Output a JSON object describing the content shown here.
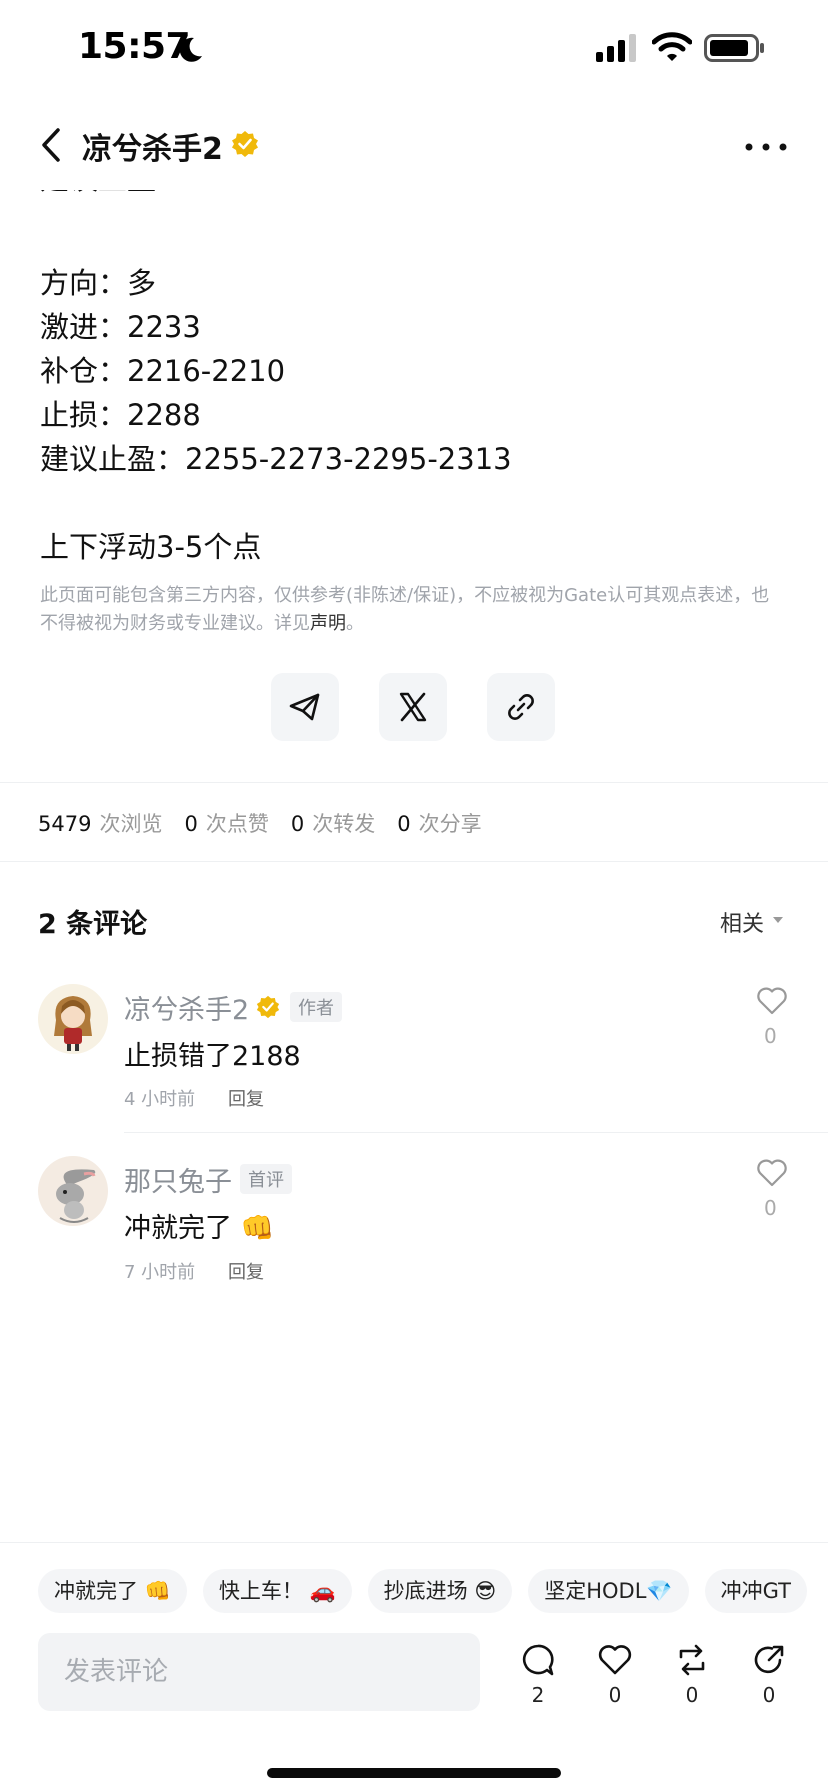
{
  "status_bar": {
    "time": "15:57"
  },
  "nav": {
    "title": "凉兮杀手2",
    "more_label": "···"
  },
  "article": {
    "clipped_line": "建议止盈：2255-2273-2295-2313",
    "lines": [
      "方向：多",
      "激进：2233",
      "补仓：2216-2210",
      "止损：2288",
      "建议止盈：2255-2273-2295-2313",
      "上下浮动3-5个点"
    ],
    "disclaimer_text": "此页面可能包含第三方内容，仅供参考(非陈述/保证)，不应被视为Gate认可其观点表述，也不得被视为财务或专业建议。详见",
    "disclaimer_link": "声明",
    "disclaimer_end": "。"
  },
  "share": {
    "icons": [
      "telegram-icon",
      "x-icon",
      "link-icon"
    ]
  },
  "stats": {
    "views": "5479",
    "views_label": "次浏览",
    "likes": "0",
    "likes_label": "次点赞",
    "reposts": "0",
    "reposts_label": "次转发",
    "shares": "0",
    "shares_label": "次分享"
  },
  "comments": {
    "heading": "2 条评论",
    "sort_label": "相关",
    "items": [
      {
        "name": "凉兮杀手2",
        "badge": "作者",
        "text": "止损错了2188",
        "time": "4 小时前",
        "reply": "回复",
        "likes": "0"
      },
      {
        "name": "那只兔子",
        "badge": "首评",
        "text": "冲就完了 👊",
        "time": "7 小时前",
        "reply": "回复",
        "likes": "0"
      }
    ]
  },
  "quick_replies": [
    "冲就完了 👊",
    "快上车！ 🚗",
    "抄底进场 😎",
    "坚定HODL💎",
    "冲冲GT"
  ],
  "composer": {
    "placeholder": "发表评论"
  },
  "actions": {
    "comments": "2",
    "likes": "0",
    "reposts": "0",
    "shares": "0"
  },
  "colors": {
    "verify_gold": "#f0b90b",
    "chip_bg": "#f4f5f7",
    "muted_text": "#a0a4ab"
  }
}
